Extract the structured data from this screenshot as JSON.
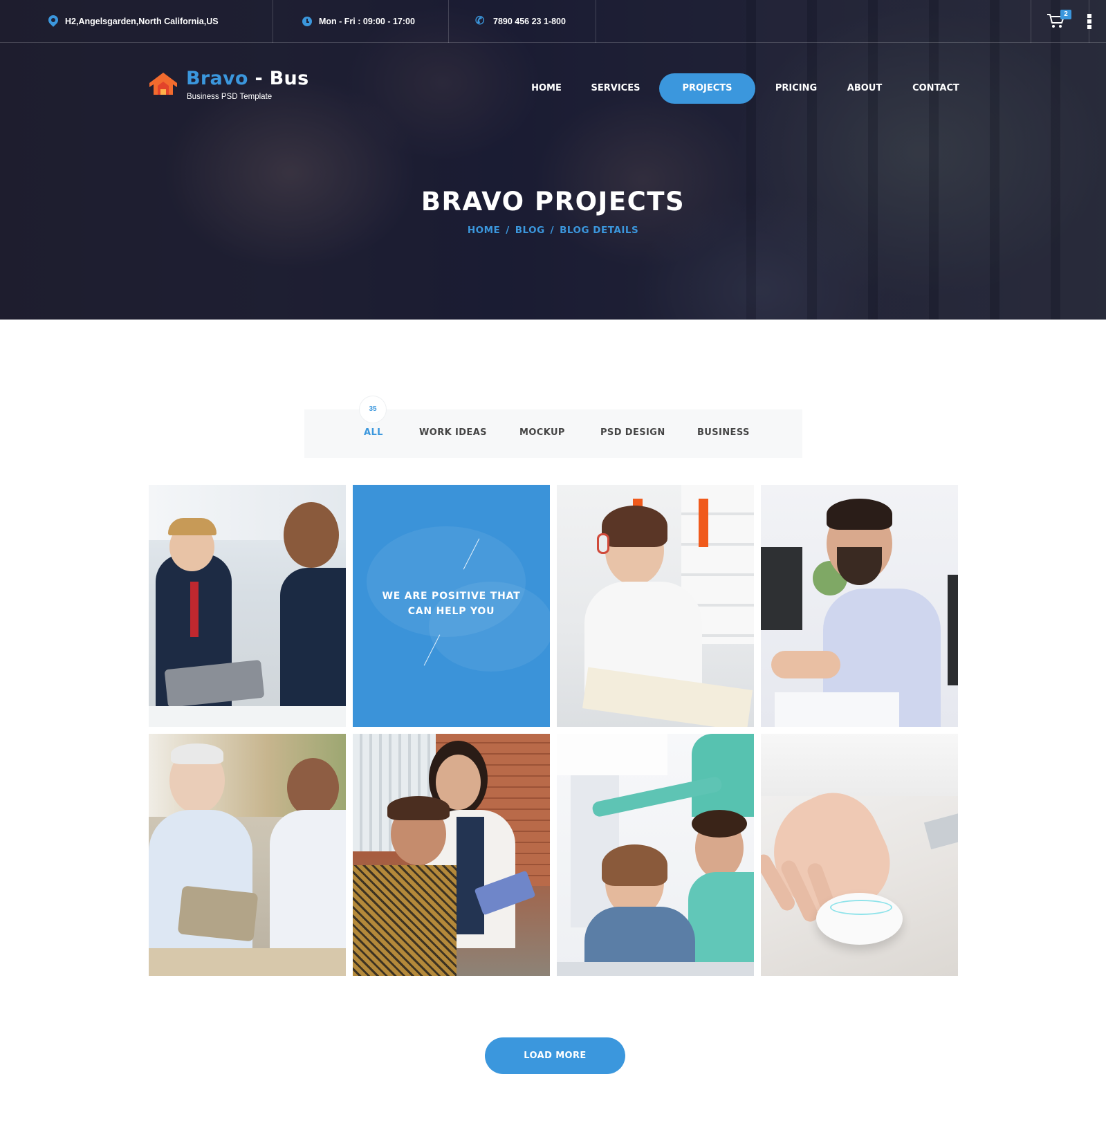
{
  "topbar": {
    "address": "H2,Angelsgarden,North California,US",
    "hours": "Mon - Fri : 09:00 - 17:00",
    "phone": "7890 456 23 1-800",
    "cart_count": "2"
  },
  "logo": {
    "brand_main": "Bravo",
    "brand_suffix": " - Bus",
    "tagline": "Business PSD Template"
  },
  "nav": {
    "items": [
      {
        "label": "HOME"
      },
      {
        "label": "SERVICES"
      },
      {
        "label": "PROJECTS",
        "active": true
      },
      {
        "label": "PRICING"
      },
      {
        "label": "ABOUT"
      },
      {
        "label": "CONTACT"
      }
    ]
  },
  "hero": {
    "title": "BRAVO PROJECTS",
    "breadcrumb": [
      "HOME",
      "BLOG",
      "BLOG DETAILS"
    ]
  },
  "filter": {
    "count": "35",
    "tabs": [
      {
        "label": "ALL",
        "active": true
      },
      {
        "label": "WORK IDEAS"
      },
      {
        "label": "MOCKUP"
      },
      {
        "label": "PSD DESIGN"
      },
      {
        "label": "BUSINESS"
      }
    ]
  },
  "grid": {
    "feature_text": "WE ARE POSITIVE THAT\nCAN HELP YOU"
  },
  "load_more_label": "LOAD MORE",
  "colors": {
    "accent": "#3b97dd",
    "logo_orange": "#f26b2e"
  }
}
